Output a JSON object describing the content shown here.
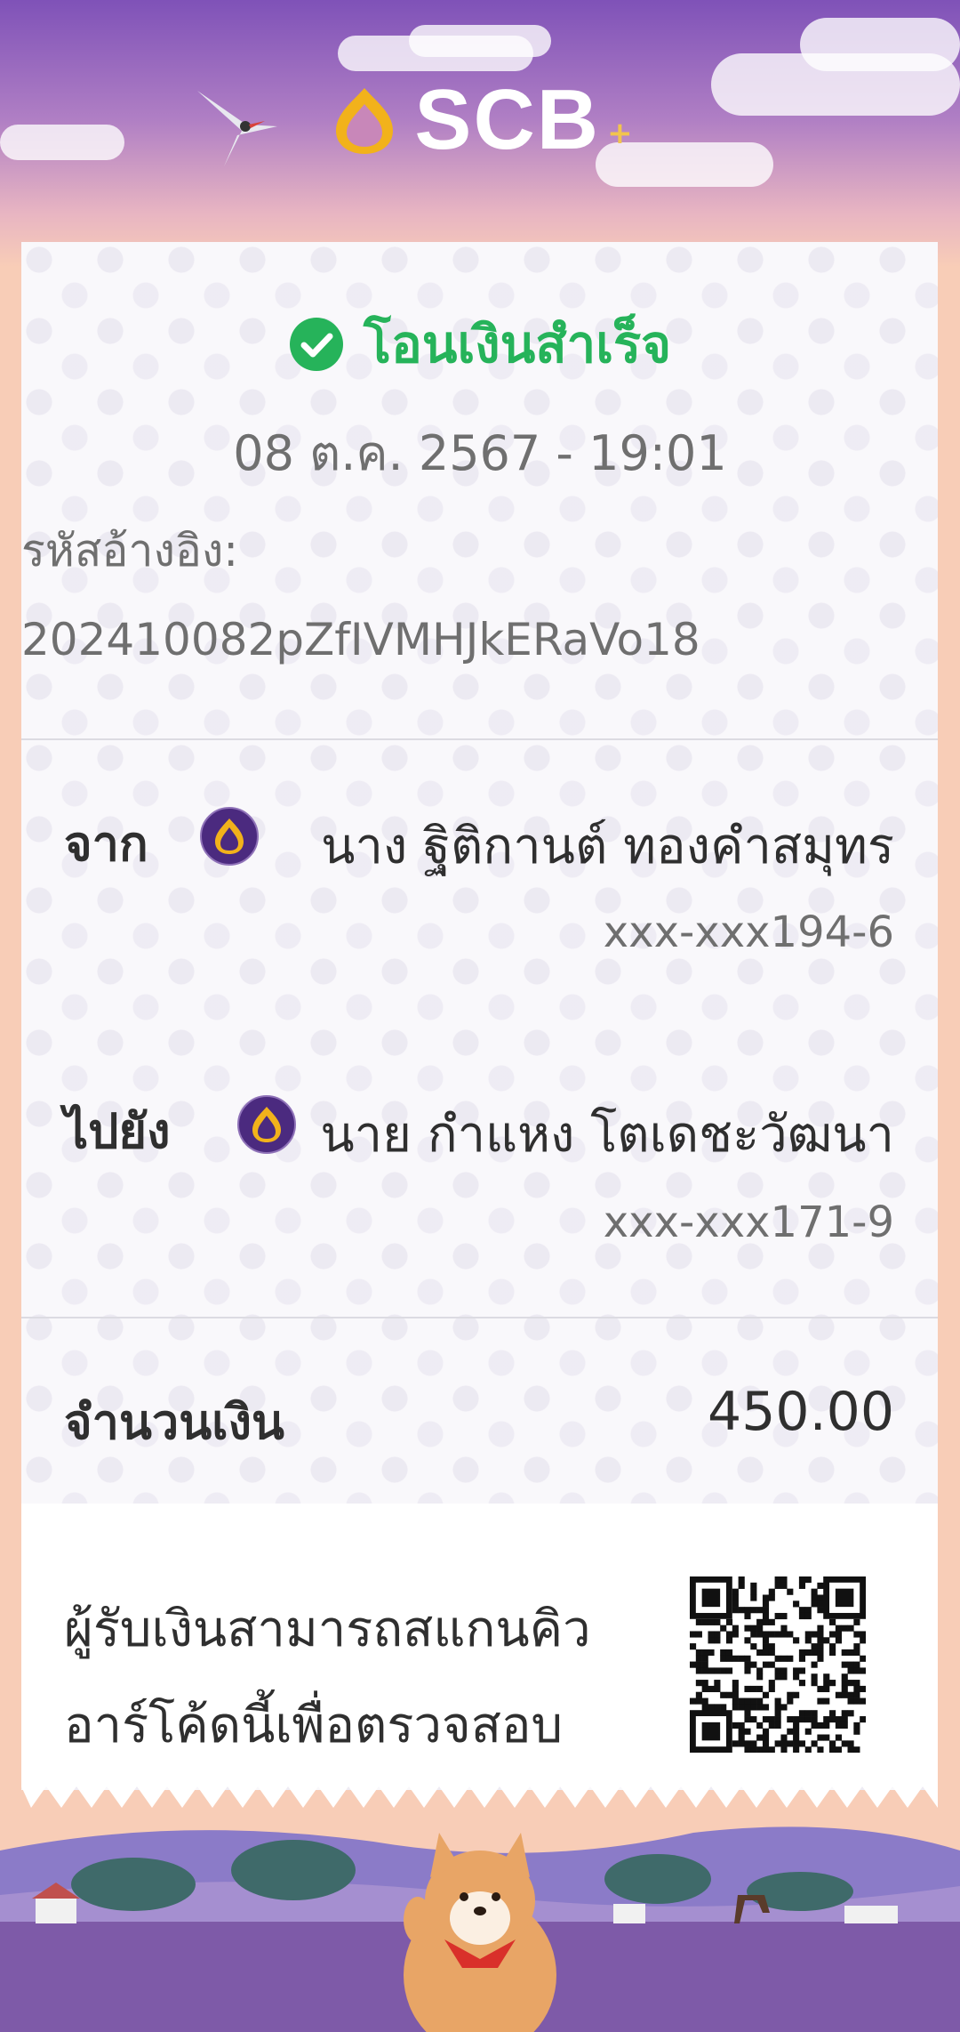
{
  "header": {
    "brand": "SCB",
    "brand_plus": "+"
  },
  "receipt": {
    "status": "โอนเงินสำเร็จ",
    "datetime": "08 ต.ค. 2567 - 19:01",
    "reference_label": "รหัสอ้างอิง:",
    "reference_value": "202410082pZfIVMHJkERaVo18",
    "from": {
      "label": "จาก",
      "name": "นาง ฐิติกานต์ ทองคำสมุทร",
      "account": "xxx-xxx194-6"
    },
    "to": {
      "label": "ไปยัง",
      "name": "นาย กำแหง โตเดชะวัฒนา",
      "account": "xxx-xxx171-9"
    },
    "amount_label": "จำนวนเงิน",
    "amount_value": "450.00",
    "qr_note_line1": "ผู้รับเงินสามารถสแกนคิว",
    "qr_note_line2": "อาร์โค้ดนี้เพื่อตรวจสอบ"
  },
  "colors": {
    "success": "#26b35a",
    "brand_purple": "#4b2a7f",
    "brand_gold": "#f2b21b",
    "page_bg": "#f8cdb7"
  },
  "icons": [
    "scb-logo-icon",
    "check-circle-icon",
    "scb-bank-icon",
    "qr-code-icon"
  ]
}
